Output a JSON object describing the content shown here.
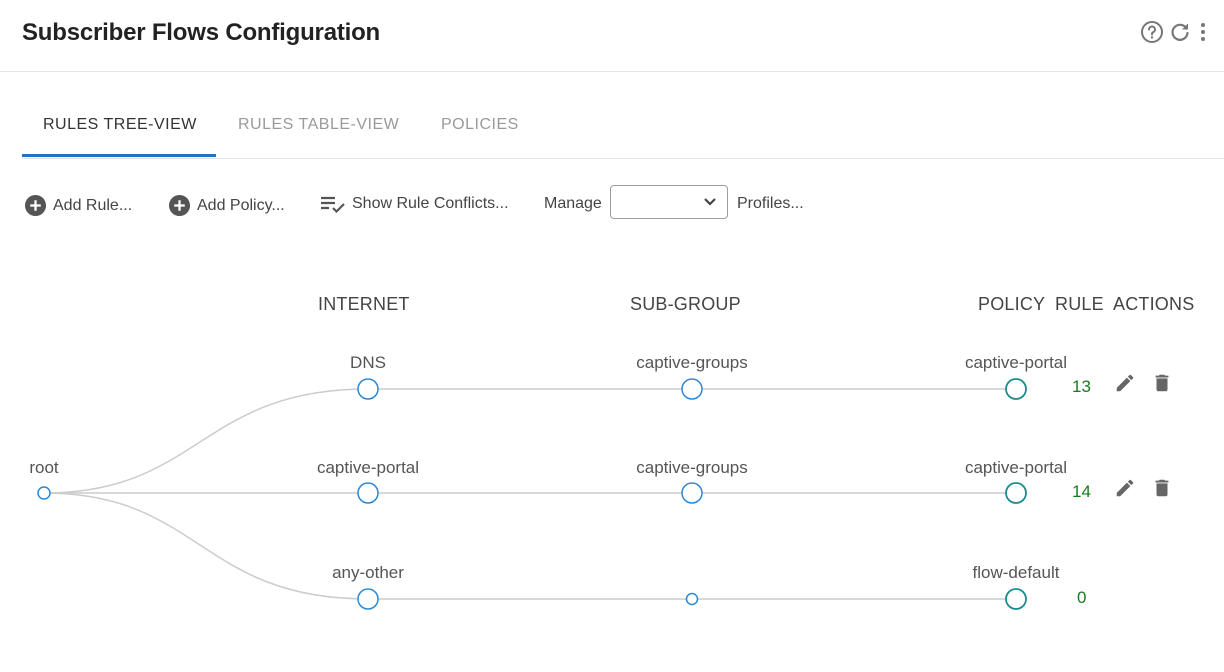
{
  "header": {
    "title": "Subscriber Flows Configuration"
  },
  "tabs": [
    {
      "label": "RULES TREE-VIEW",
      "active": true
    },
    {
      "label": "RULES TABLE-VIEW",
      "active": false
    },
    {
      "label": "POLICIES",
      "active": false
    }
  ],
  "toolbar": {
    "add_rule": "Add Rule...",
    "add_policy": "Add Policy...",
    "show_conflicts": "Show Rule Conflicts...",
    "manage_label": "Manage",
    "manage_value": "",
    "profiles": "Profiles..."
  },
  "columns": {
    "internet": "INTERNET",
    "subgroup": "SUB-GROUP",
    "policy": "POLICY",
    "rule": "RULE",
    "actions": "ACTIONS"
  },
  "tree": {
    "root": "root",
    "rows": [
      {
        "internet": "DNS",
        "subgroup": "captive-groups",
        "policy": "captive-portal",
        "rule": "13",
        "has_actions": true
      },
      {
        "internet": "captive-portal",
        "subgroup": "captive-groups",
        "policy": "captive-portal",
        "rule": "14",
        "has_actions": true
      },
      {
        "internet": "any-other",
        "subgroup": "",
        "policy": "flow-default",
        "rule": "0",
        "has_actions": false
      }
    ]
  },
  "colors": {
    "accent": "#1f73c7",
    "node_blue": "#2a8ad8",
    "node_teal": "#1c8c8c",
    "rule_green": "#1a7a1a",
    "link": "#cccccc"
  }
}
